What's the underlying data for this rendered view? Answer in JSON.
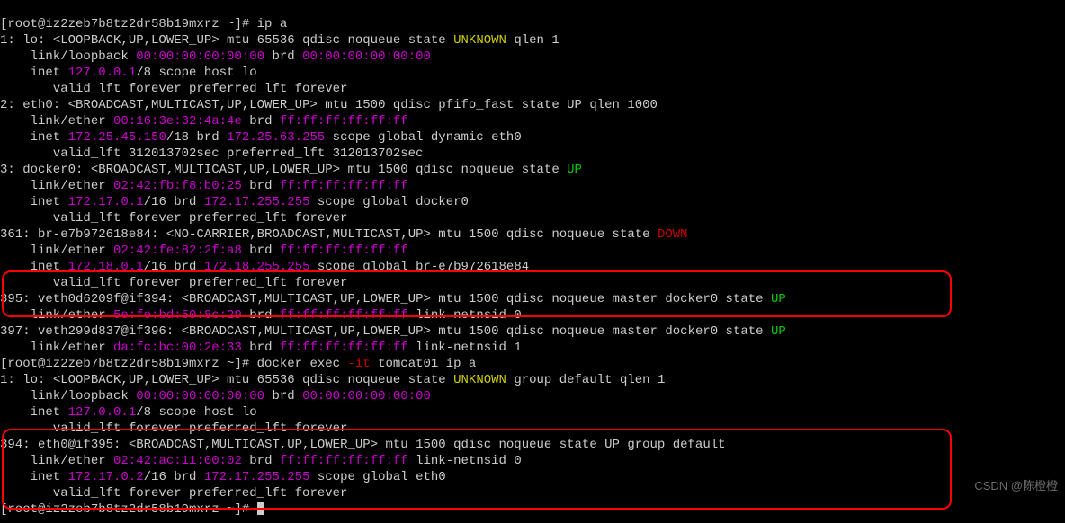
{
  "prompt1": "[root@iz2zeb7b8tz2dr58b19mxrz ~]# ",
  "cmd1": "ip a",
  "if1": {
    "idx": "1: lo: ",
    "flags": "<LOOPBACK,UP,LOWER_UP>",
    "rest": " mtu 65536 qdisc noqueue state ",
    "state": "UNKNOWN",
    "qlen": " qlen 1",
    "linktype": "    link/loopback ",
    "mac": "00:00:00:00:00:00",
    "brd_lbl": " brd ",
    "brd": "00:00:00:00:00:00",
    "inet_pre": "    inet ",
    "inet": "127.0.0.1",
    "inet_post": "/8 scope host lo",
    "valid": "       valid_lft forever preferred_lft forever"
  },
  "if2": {
    "idx": "2: eth0: ",
    "flags": "<BROADCAST,MULTICAST,UP,LOWER_UP>",
    "rest": " mtu 1500 qdisc pfifo_fast state UP qlen 1000",
    "linktype": "    link/ether ",
    "mac": "00:16:3e:32:4a:4e",
    "brd_lbl": " brd ",
    "brd": "ff:ff:ff:ff:ff:ff",
    "inet_pre": "    inet ",
    "inet": "172.25.45.150",
    "inet_mid": "/18 brd ",
    "inet_brd": "172.25.63.255",
    "inet_post": " scope global dynamic eth0",
    "valid": "       valid_lft 312013702sec preferred_lft 312013702sec"
  },
  "if3": {
    "idx": "3: docker0: ",
    "flags": "<BROADCAST,MULTICAST,UP,LOWER_UP>",
    "rest": " mtu 1500 qdisc noqueue state ",
    "state": "UP",
    "linktype": "    link/ether ",
    "mac": "02:42:fb:f8:b0:25",
    "brd_lbl": " brd ",
    "brd": "ff:ff:ff:ff:ff:ff",
    "inet_pre": "    inet ",
    "inet": "172.17.0.1",
    "inet_mid": "/16 brd ",
    "inet_brd": "172.17.255.255",
    "inet_post": " scope global docker0",
    "valid": "       valid_lft forever preferred_lft forever"
  },
  "if361": {
    "idx": "361: br-e7b972618e84: ",
    "flags": "<NO-CARRIER,BROADCAST,MULTICAST,UP>",
    "rest": " mtu 1500 qdisc noqueue state ",
    "state": "DOWN",
    "linktype": "    link/ether ",
    "mac": "02:42:fe:82:2f:a8",
    "brd_lbl": " brd ",
    "brd": "ff:ff:ff:ff:ff:ff",
    "inet_pre": "    inet ",
    "inet": "172.18.0.1",
    "inet_mid": "/16 brd ",
    "inet_brd": "172.18.255.255",
    "inet_post": " scope global br-e7b972618e84",
    "valid": "       valid_lft forever preferred_lft forever"
  },
  "if395": {
    "idx": "395: veth0d6209f@if394: ",
    "flags": "<BROADCAST,MULTICAST,UP,LOWER_UP>",
    "rest": " mtu 1500 qdisc noqueue master docker0 state ",
    "state": "UP",
    "linktype": "    link/ether ",
    "mac": "5e:fe:bd:50:8c:29",
    "brd_lbl": " brd ",
    "brd": "ff:ff:ff:ff:ff:ff",
    "post": " link-netnsid 0"
  },
  "if397": {
    "idx": "397: veth299d837@if396: ",
    "flags": "<BROADCAST,MULTICAST,UP,LOWER_UP>",
    "rest": " mtu 1500 qdisc noqueue master docker0 state ",
    "state": "UP",
    "linktype": "    link/ether ",
    "mac": "da:fc:bc:00:2e:33",
    "brd_lbl": " brd ",
    "brd": "ff:ff:ff:ff:ff:ff",
    "post": " link-netnsid 1"
  },
  "prompt2": "[root@iz2zeb7b8tz2dr58b19mxrz ~]# ",
  "cmd2a": "docker exec ",
  "cmd2b": "-it",
  "cmd2c": " tomcat01 ip a",
  "cif1": {
    "idx": "1: lo: ",
    "flags": "<LOOPBACK,UP,LOWER_UP>",
    "rest": " mtu 65536 qdisc noqueue state ",
    "state": "UNKNOWN",
    "post": " group default qlen 1",
    "linktype": "    link/loopback ",
    "mac": "00:00:00:00:00:00",
    "brd_lbl": " brd ",
    "brd": "00:00:00:00:00:00",
    "inet_pre": "    inet ",
    "inet": "127.0.0.1",
    "inet_post": "/8 scope host lo",
    "valid": "       valid_lft forever preferred_lft forever"
  },
  "cif394": {
    "idx": "394: eth0@if395: ",
    "flags": "<BROADCAST,MULTICAST,UP,LOWER_UP>",
    "rest": " mtu 1500 qdisc noqueue state UP group default",
    "linktype": "    link/ether ",
    "mac": "02:42:ac:11:00:02",
    "brd_lbl": " brd ",
    "brd": "ff:ff:ff:ff:ff:ff",
    "post": " link-netnsid 0",
    "inet_pre": "    inet ",
    "inet": "172.17.0.2",
    "inet_mid": "/16 brd ",
    "inet_brd": "172.17.255.255",
    "inet_post": " scope global eth0",
    "valid": "       valid_lft forever preferred_lft forever"
  },
  "prompt3": "[root@iz2zeb7b8tz2dr58b19mxrz ~]# ",
  "watermark": "CSDN @陈橙橙"
}
